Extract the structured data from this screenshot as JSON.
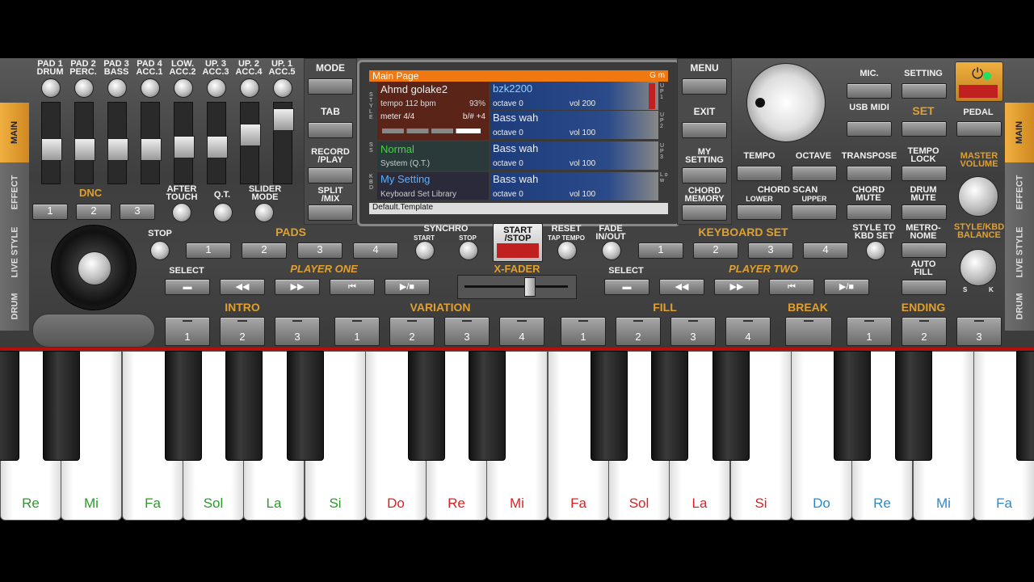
{
  "pad_labels": [
    [
      "PAD 1",
      "DRUM"
    ],
    [
      "PAD 2",
      "PERC."
    ],
    [
      "PAD 3",
      "BASS"
    ],
    [
      "PAD 4",
      "ACC.1"
    ],
    [
      "LOW.",
      "ACC.2"
    ],
    [
      "UP. 3",
      "ACC.3"
    ],
    [
      "UP. 2",
      "ACC.4"
    ],
    [
      "UP. 1",
      "ACC.5"
    ]
  ],
  "dnc": {
    "label": "DNC",
    "buttons": [
      "1",
      "2",
      "3"
    ],
    "after_touch": "AFTER TOUCH",
    "qt": "Q.T.",
    "slider_mode": "SLIDER MODE"
  },
  "left_tabs": [
    "MAIN",
    "EFFECT",
    "LIVE STYLE",
    "DRUM"
  ],
  "right_tabs": [
    "MAIN",
    "EFFECT",
    "LIVE STYLE",
    "DRUM"
  ],
  "center_left": {
    "mode": "MODE",
    "tab": "TAB",
    "record": "RECORD /PLAY",
    "split": "SPLIT /MIX"
  },
  "center_right": {
    "menu": "MENU",
    "exit": "EXIT",
    "my_setting": "MY SETTING",
    "chord_memory": "CHORD MEMORY"
  },
  "screen": {
    "title": "Main Page",
    "key": "G m",
    "style_name": "Ahmd golake2",
    "tempo": "tempo 112 bpm",
    "percent": "93%",
    "meter": "meter 4/4",
    "transpose": "b/# +4",
    "upper1_name": "bzk2200",
    "upper1_octave": "octave  0",
    "upper1_vol": "vol 200",
    "upper2_name": "Bass wah",
    "upper2_octave": "octave  0",
    "upper2_vol": "vol 100",
    "sound_name": "Normal",
    "sound_sub": "System (Q.T.)",
    "upper3_name": "Bass wah",
    "upper3_octave": "octave  0",
    "upper3_vol": "vol 100",
    "kbd_name": "My Setting",
    "kbd_sub": "Keyboard Set Library",
    "low_name": "Bass wah",
    "low_octave": "octave  0",
    "low_vol": "vol 100",
    "footer": "Default.Template",
    "side_style": "S T Y L E",
    "side_sound": "S S",
    "side_kbd": "K B D",
    "side_right": [
      "U P 1",
      "U P 2",
      "U P 3",
      "L o w"
    ]
  },
  "right_panel": {
    "mic": "MIC.",
    "setting": "SETTING",
    "usb_midi": "USB MIDI",
    "set": "SET",
    "pedal": "PEDAL",
    "tempo": "TEMPO",
    "octave": "OCTAVE",
    "transpose": "TRANSPOSE",
    "tempo_lock": "TEMPO LOCK",
    "master_volume": "MASTER VOLUME",
    "chord_scan": "CHORD SCAN",
    "lower": "LOWER",
    "upper": "UPPER",
    "chord_mute": "CHORD MUTE",
    "drum_mute": "DRUM MUTE",
    "style_to_kbd": "STYLE TO KBD SET",
    "metronome": "METRO- NOME",
    "auto_fill": "AUTO FILL",
    "style_kbd_balance": "STYLE/KBD BALANCE",
    "s": "S",
    "k": "K"
  },
  "pads": {
    "stop": "STOP",
    "label": "PADS",
    "buttons": [
      "1",
      "2",
      "3",
      "4"
    ]
  },
  "synchro": {
    "label": "SYNCHRO",
    "start": "START",
    "stop": "STOP"
  },
  "start_stop": "START /STOP",
  "reset": "RESET",
  "tap_tempo": "TAP TEMPO",
  "fade": "FADE IN/OUT",
  "keyboard_set": {
    "label": "KEYBOARD SET",
    "buttons": [
      "1",
      "2",
      "3",
      "4"
    ]
  },
  "player_one": {
    "select": "SELECT",
    "label": "PLAYER ONE"
  },
  "player_two": {
    "select": "SELECT",
    "label": "PLAYER TWO"
  },
  "xfader": "X-FADER",
  "sections": {
    "intro": "INTRO",
    "variation": "VARIATION",
    "fill": "FILL",
    "break": "BREAK",
    "ending": "ENDING"
  },
  "section_buttons": {
    "intro": [
      "1",
      "2",
      "3"
    ],
    "variation": [
      "1",
      "2",
      "3",
      "4"
    ],
    "fill": [
      "1",
      "2",
      "3",
      "4"
    ],
    "ending": [
      "1",
      "2",
      "3"
    ]
  },
  "keys": [
    {
      "label": "Re",
      "color": "#2a9a2a"
    },
    {
      "label": "Mi",
      "color": "#2a9a2a"
    },
    {
      "label": "Fa",
      "color": "#2a9a2a"
    },
    {
      "label": "Sol",
      "color": "#2a9a2a"
    },
    {
      "label": "La",
      "color": "#2a9a2a"
    },
    {
      "label": "Si",
      "color": "#2a9a2a"
    },
    {
      "label": "Do",
      "color": "#e02020"
    },
    {
      "label": "Re",
      "color": "#e02020"
    },
    {
      "label": "Mi",
      "color": "#e02020"
    },
    {
      "label": "Fa",
      "color": "#e02020"
    },
    {
      "label": "Sol",
      "color": "#e02020"
    },
    {
      "label": "La",
      "color": "#e02020"
    },
    {
      "label": "Si",
      "color": "#e02020"
    },
    {
      "label": "Do",
      "color": "#2a8ad0"
    },
    {
      "label": "Re",
      "color": "#2a8ad0"
    },
    {
      "label": "Mi",
      "color": "#2a8ad0"
    },
    {
      "label": "Fa",
      "color": "#2a8ad0"
    }
  ],
  "colors": {
    "accent": "#e0a030",
    "screen_header": "#f07810",
    "active_red": "#c02020"
  }
}
